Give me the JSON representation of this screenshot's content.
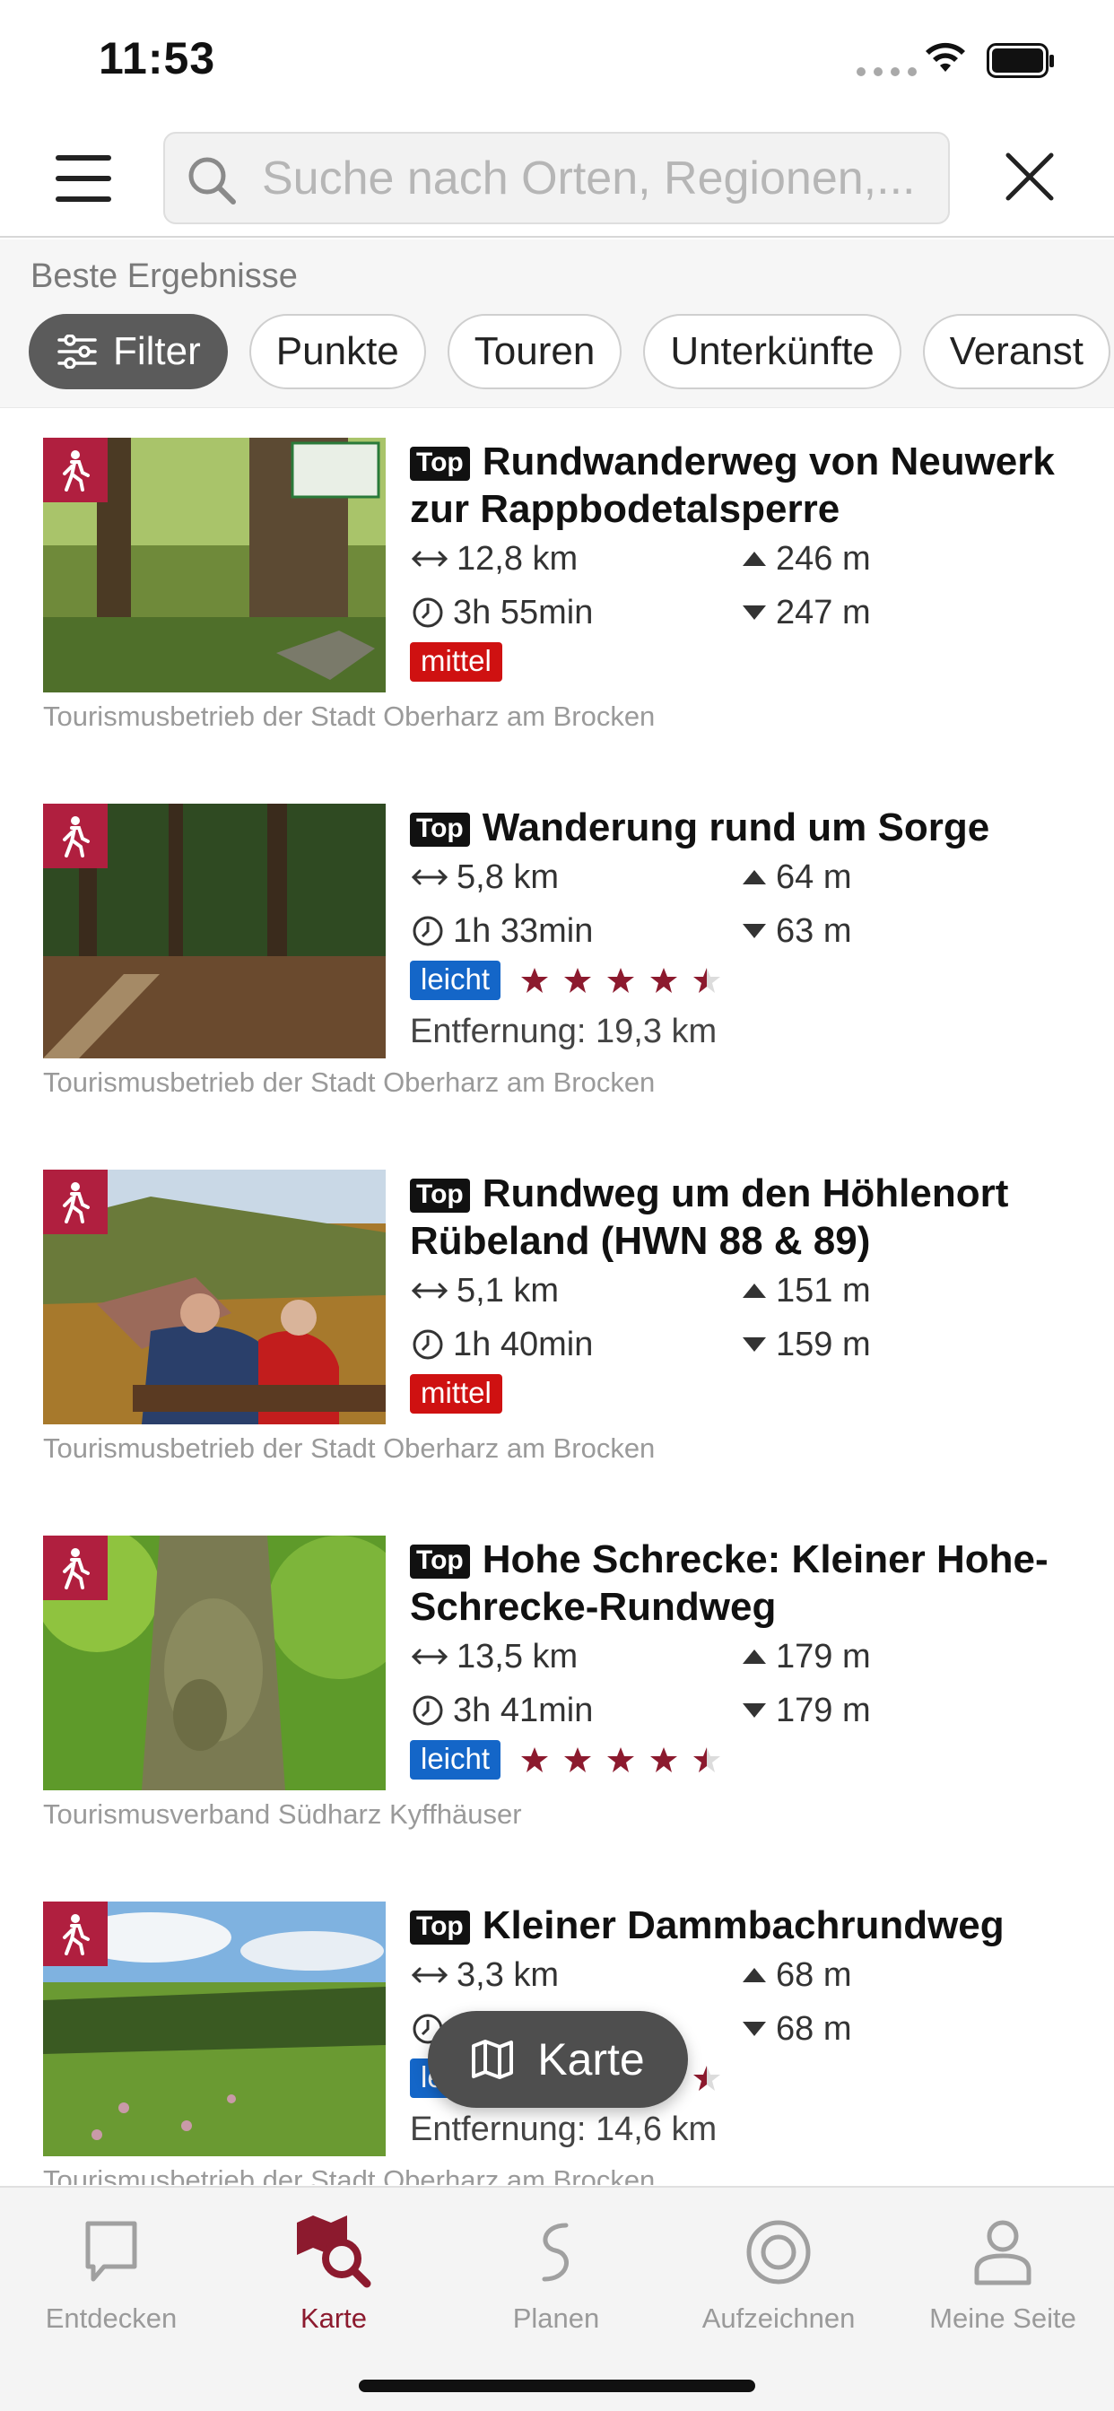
{
  "status_bar": {
    "time": "11:53"
  },
  "search": {
    "placeholder": "Suche nach Orten, Regionen,..."
  },
  "filters": {
    "label": "Beste Ergebnisse",
    "chips": [
      "Filter",
      "Punkte",
      "Touren",
      "Unterkünfte",
      "Veranst"
    ]
  },
  "results": [
    {
      "tag": "Top",
      "title": "Rundwanderweg von Neuwerk zur Rappbodetalsperre",
      "distance": "12,8 km",
      "duration": "3h 55min",
      "ascent": "246 m",
      "descent": "247 m",
      "difficulty": "mittel",
      "rating": null,
      "distance_from_user": "",
      "source": "Tourismusbetrieb der Stadt Oberharz am Brocken"
    },
    {
      "tag": "Top",
      "title": "Wanderung rund um Sorge",
      "distance": "5,8 km",
      "duration": "1h 33min",
      "ascent": "64 m",
      "descent": "63 m",
      "difficulty": "leicht",
      "rating": 4.5,
      "distance_from_user": "Entfernung: 19,3 km",
      "source": "Tourismusbetrieb der Stadt Oberharz am Brocken"
    },
    {
      "tag": "Top",
      "title": "Rundweg um den Höhlenort Rübeland (HWN 88 & 89)",
      "distance": "5,1 km",
      "duration": "1h 40min",
      "ascent": "151 m",
      "descent": "159 m",
      "difficulty": "mittel",
      "rating": null,
      "distance_from_user": "",
      "source": "Tourismusbetrieb der Stadt Oberharz am Brocken"
    },
    {
      "tag": "Top",
      "title": "Hohe Schrecke: Kleiner Hohe-Schrecke-Rundweg",
      "distance": "13,5 km",
      "duration": "3h 41min",
      "ascent": "179 m",
      "descent": "179 m",
      "difficulty": "leicht",
      "rating": 4.5,
      "distance_from_user": "",
      "source": "Tourismusverband Südharz Kyffhäuser"
    },
    {
      "tag": "Top",
      "title": "Kleiner Dammbachrundweg",
      "distance": "3,3 km",
      "duration": "",
      "ascent": "68 m",
      "descent": "68 m",
      "difficulty": "leicht",
      "rating": 4.5,
      "distance_from_user": "Entfernung: 14,6 km",
      "source": "Tourismusbetrieb der Stadt Oberharz am Brocken"
    }
  ],
  "fab": {
    "label": "Karte"
  },
  "tabbar": [
    {
      "label": "Entdecken",
      "icon": "speech-bubble-icon",
      "active": false
    },
    {
      "label": "Karte",
      "icon": "map-search-icon",
      "active": true
    },
    {
      "label": "Planen",
      "icon": "route-icon",
      "active": false
    },
    {
      "label": "Aufzeichnen",
      "icon": "record-icon",
      "active": false
    },
    {
      "label": "Meine Seite",
      "icon": "profile-icon",
      "active": false
    }
  ],
  "colors": {
    "accent": "#b01f3f",
    "tab_active": "#8c1a2e",
    "mittel": "#cf1111",
    "leicht": "#1466c8",
    "star": "#8c1a2e"
  }
}
